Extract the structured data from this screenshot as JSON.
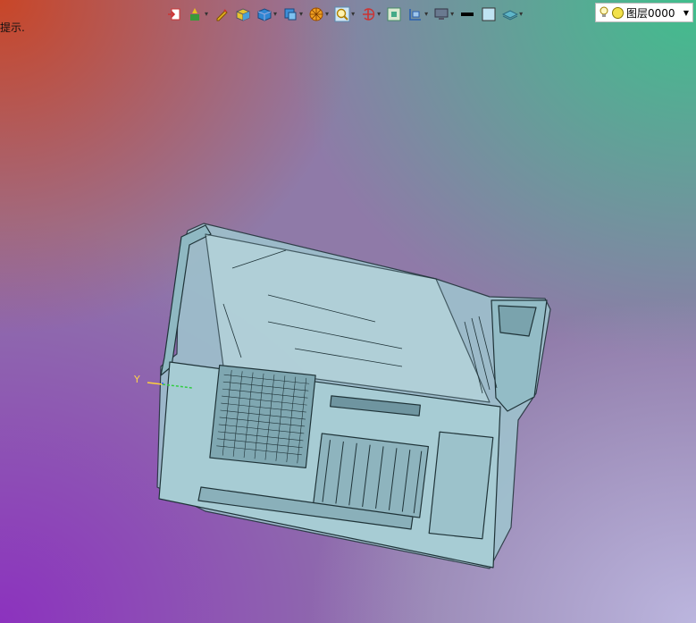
{
  "hint_text": "提示.",
  "toolbar": {
    "tools": [
      {
        "icon": "import-icon",
        "dropdown": false
      },
      {
        "icon": "paint-brush-icon",
        "dropdown": true
      },
      {
        "icon": "pen-icon",
        "dropdown": false
      },
      {
        "icon": "box-shaded-icon",
        "dropdown": false
      },
      {
        "icon": "cube-icon",
        "dropdown": true
      },
      {
        "icon": "view-cube-icon",
        "dropdown": true
      },
      {
        "icon": "render-sphere-icon",
        "dropdown": true
      },
      {
        "icon": "zoom-icon",
        "dropdown": true
      },
      {
        "icon": "rotate-icon",
        "dropdown": true
      },
      {
        "icon": "fit-view-icon",
        "dropdown": false
      },
      {
        "icon": "section-icon",
        "dropdown": true
      },
      {
        "icon": "display-icon",
        "dropdown": true
      },
      {
        "icon": "line-color-icon",
        "dropdown": false
      },
      {
        "icon": "fill-color-icon",
        "dropdown": false
      },
      {
        "icon": "layer-icon",
        "dropdown": true
      }
    ]
  },
  "layer": {
    "current": "图层0000"
  },
  "axis": {
    "y_label": "Y"
  },
  "colors": {
    "model_fill": "#9fc6cf",
    "model_edge": "#1f3338"
  }
}
